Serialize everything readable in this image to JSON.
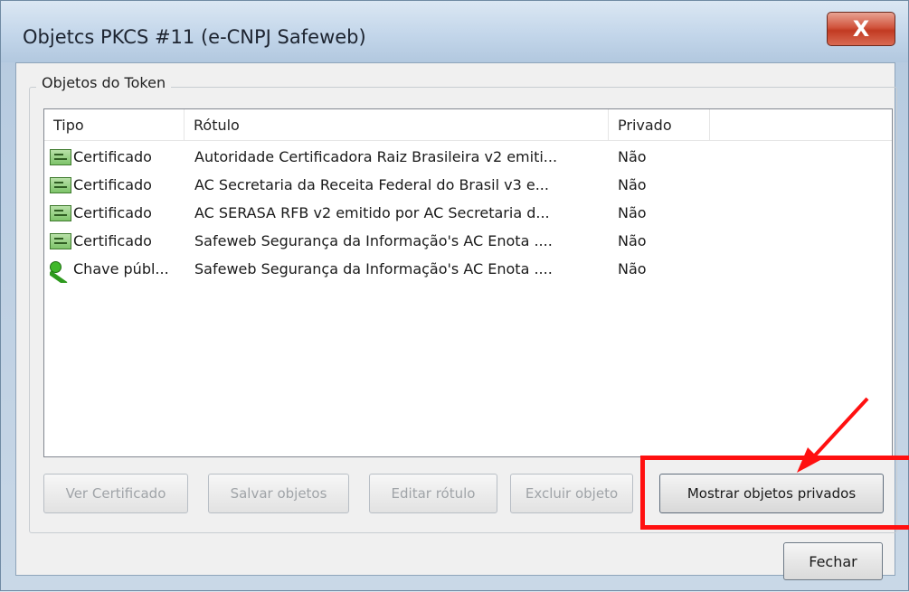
{
  "window": {
    "title": "Objetcs PKCS #11 (e-CNPJ Safeweb)",
    "close_glyph": "X"
  },
  "group": {
    "legend": "Objetos do Token"
  },
  "list": {
    "columns": [
      "Tipo",
      "Rótulo",
      "Privado"
    ],
    "rows": [
      {
        "icon": "certificate-icon",
        "type": "Certificado",
        "label": "Autoridade Certificadora Raiz Brasileira v2 emiti...",
        "private": "Não"
      },
      {
        "icon": "certificate-icon",
        "type": "Certificado",
        "label": "AC Secretaria da Receita Federal do Brasil v3 e...",
        "private": "Não"
      },
      {
        "icon": "certificate-icon",
        "type": "Certificado",
        "label": "AC SERASA RFB v2 emitido por AC Secretaria d...",
        "private": "Não"
      },
      {
        "icon": "certificate-icon",
        "type": "Certificado",
        "label": "Safeweb Segurança da Informação's AC Enota ....",
        "private": "Não"
      },
      {
        "icon": "key-icon",
        "type": "Chave públ...",
        "label": "Safeweb Segurança da Informação's AC Enota ....",
        "private": "Não"
      }
    ]
  },
  "buttons": {
    "view_cert": "Ver Certificado",
    "save_objects": "Salvar objetos",
    "edit_label": "Editar rótulo",
    "delete_object": "Excluir objeto",
    "show_private": "Mostrar objetos privados",
    "close": "Fechar"
  },
  "colors": {
    "highlight": "#ff1010"
  }
}
